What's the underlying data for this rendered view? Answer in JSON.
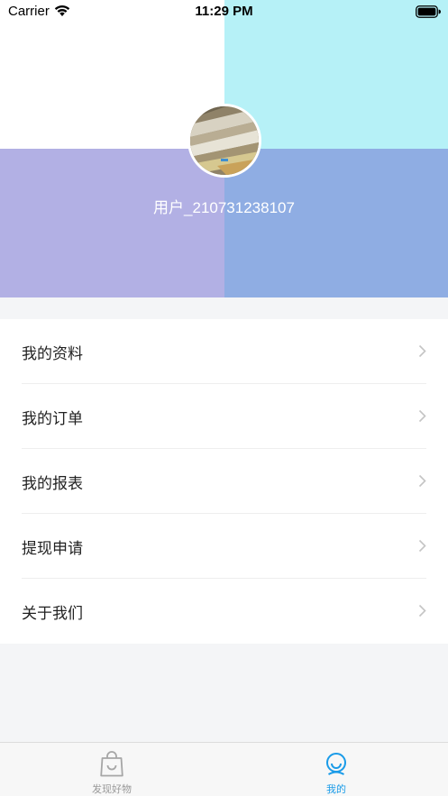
{
  "status_bar": {
    "carrier": "Carrier",
    "time": "11:29 PM",
    "wifi_icon": "wifi-icon",
    "battery_icon": "battery-full-icon"
  },
  "header": {
    "quadrant_colors": [
      "#ffffff",
      "#b6f1f7",
      "#b2b0e4",
      "#8fade3"
    ],
    "username": "用户_210731238107"
  },
  "menu": {
    "items": [
      {
        "label": "我的资料"
      },
      {
        "label": "我的订单"
      },
      {
        "label": "我的报表"
      },
      {
        "label": "提现申请"
      },
      {
        "label": "关于我们"
      }
    ],
    "chevron_icon": "chevron-right-icon"
  },
  "tab_bar": {
    "tabs": [
      {
        "label": "发现好物",
        "icon": "shopping-bag-icon",
        "active": false
      },
      {
        "label": "我的",
        "icon": "profile-face-icon",
        "active": true
      }
    ],
    "active_color": "#1a9be8",
    "inactive_color": "#999999"
  }
}
